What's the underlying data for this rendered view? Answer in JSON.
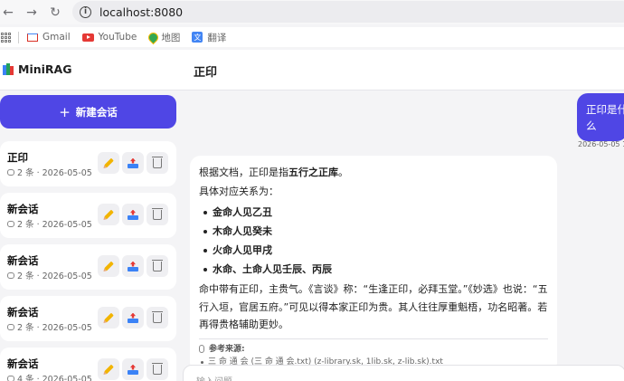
{
  "browser": {
    "url": "localhost:8080",
    "bookmarks": [
      {
        "label": "Gmail",
        "icon": "gmail-icon"
      },
      {
        "label": "YouTube",
        "icon": "youtube-icon"
      },
      {
        "label": "地图",
        "icon": "maps-icon"
      },
      {
        "label": "翻译",
        "icon": "translate-icon"
      }
    ]
  },
  "app": {
    "brand": "MiniRAG",
    "chat_title": "正印",
    "accent": "#4f46e5"
  },
  "sidebar": {
    "new_chat_label": "新建会话",
    "conversations": [
      {
        "title": "正印",
        "meta": "2 条 · 2026-05-05"
      },
      {
        "title": "新会话",
        "meta": "2 条 · 2026-05-05"
      },
      {
        "title": "新会话",
        "meta": "2 条 · 2026-05-05"
      },
      {
        "title": "新会话",
        "meta": "2 条 · 2026-05-05"
      },
      {
        "title": "新会话",
        "meta": "4 条 · 2026-05-05"
      }
    ]
  },
  "chat": {
    "user_message": "正印是什么",
    "user_timestamp": "2026-05-05 1",
    "answer": {
      "intro_prefix": "根据文档，正印是指",
      "intro_bold": "五行之正库",
      "intro_suffix": "。",
      "relation_label": "具体对应关系为：",
      "items": [
        "金命人见乙丑",
        "木命人见癸未",
        "火命人见甲戌",
        "水命、土命人见壬辰、丙辰"
      ],
      "paragraph": "命中带有正印，主贵气。《言谈》称：“生逢正印，必拜玉堂。”《妙选》也说：“五行入垣，官居五府。”可见以得本家正印为贵。其人往往厚重魁梧，功名昭著。若再得贵格辅助更妙。",
      "refs_title": "参考来源:",
      "refs": [
        "三 命 通 会 (三 命 通 会.txt) (z-library.sk, 1lib.sk, z-lib.sk).txt"
      ]
    },
    "input_placeholder": "输入问题"
  }
}
